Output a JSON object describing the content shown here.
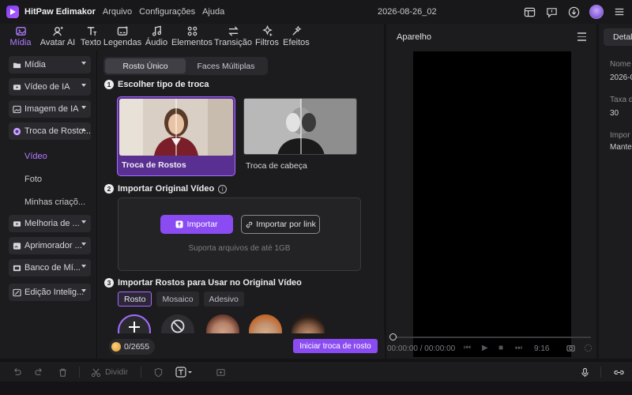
{
  "app": {
    "name": "HitPaw Edimakor",
    "menu": [
      "Arquivo",
      "Configurações",
      "Ajuda"
    ],
    "doc_title": "2026-08-26_02"
  },
  "toolbar": {
    "tabs": [
      {
        "label": "Mídia",
        "icon": "media-icon",
        "active": true
      },
      {
        "label": "Avatar AI",
        "icon": "avatar-ai-icon"
      },
      {
        "label": "Texto",
        "icon": "text-icon"
      },
      {
        "label": "Legendas",
        "icon": "captions-icon"
      },
      {
        "label": "Áudio",
        "icon": "audio-icon"
      },
      {
        "label": "Elementos",
        "icon": "elements-icon"
      },
      {
        "label": "Transição",
        "icon": "transition-icon"
      },
      {
        "label": "Filtros",
        "icon": "filters-icon"
      },
      {
        "label": "Efeitos",
        "icon": "effects-icon"
      }
    ]
  },
  "sidebar": {
    "items": [
      {
        "label": "Mídia",
        "icon": "folder-icon"
      },
      {
        "label": "Vídeo de IA",
        "icon": "ai-video-icon"
      },
      {
        "label": "Imagem de IA",
        "icon": "ai-image-icon"
      },
      {
        "label": "Troca de Rosto...",
        "icon": "face-swap-icon",
        "expanded": true
      },
      {
        "label": "Melhoria de ...",
        "icon": "enhance-icon"
      },
      {
        "label": "Aprimorador ...",
        "icon": "enhancer-icon"
      },
      {
        "label": "Banco de Mí...",
        "icon": "media-bank-icon"
      },
      {
        "label": "Edição Intelig...",
        "icon": "smart-edit-icon"
      }
    ],
    "sub_items": [
      {
        "label": "Vídeo",
        "active": true
      },
      {
        "label": "Foto"
      },
      {
        "label": "Minhas criaçõ..."
      }
    ]
  },
  "faceswap": {
    "segments": [
      "Rosto Único",
      "Faces Múltiplas"
    ],
    "step1": {
      "num": "1",
      "title": "Escolher tipo de troca"
    },
    "cards": [
      {
        "label": "Troca de Rostos",
        "selected": true
      },
      {
        "label": "Troca de cabeça",
        "selected": false
      }
    ],
    "step2": {
      "num": "2",
      "title": "Importar Original Vídeo"
    },
    "import_button": "Importar",
    "import_link_button": "Importar por link",
    "import_hint": "Suporta arquivos de até 1GB",
    "step3": {
      "num": "3",
      "title": "Importar Rostos para Usar no Original Vídeo"
    },
    "chips": [
      "Rosto",
      "Mosaico",
      "Adesivo"
    ],
    "credits": "0/2655",
    "start_button": "Iniciar troca de rosto"
  },
  "player": {
    "title": "Aparelho",
    "time": "00:00:00 / 00:00:00",
    "ratio": "9:16"
  },
  "details": {
    "tab": "Detalhes",
    "fields": [
      {
        "label": "Nome",
        "value": "2026-0"
      },
      {
        "label": "Taxa d",
        "value": "30"
      },
      {
        "label": "Impor",
        "value": "Mante"
      }
    ]
  },
  "bottombar": {
    "split_label": "Dividir"
  },
  "colors": {
    "accent": "#8a4cf2",
    "accent_text": "#b07cff",
    "background": "#1c1c1f"
  }
}
